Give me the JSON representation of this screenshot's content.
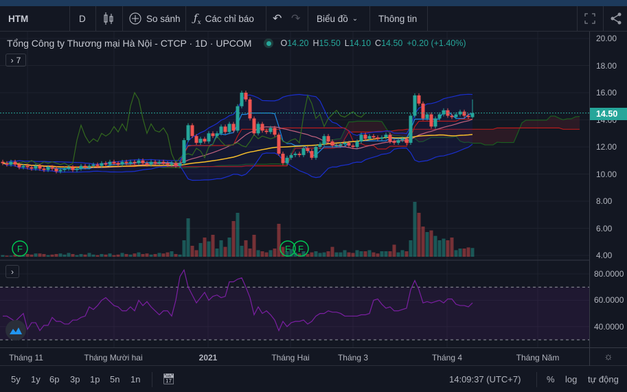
{
  "toolbar": {
    "symbol": "HTM",
    "interval": "D",
    "compare_label": "So sánh",
    "indicators_label": "Các chỉ báo",
    "chart_label": "Biểu đồ",
    "info_label": "Thông tin"
  },
  "legend": {
    "title": "Tổng Công ty Thương mại Hà Nội - CTCP · 1D · UPCOM",
    "open_key": "O",
    "open": "14.20",
    "high_key": "H",
    "high": "15.50",
    "low_key": "L",
    "low": "14.10",
    "close_key": "C",
    "close": "14.50",
    "change": "+0.20 (+1.40%)",
    "indicator_count": "7"
  },
  "price_axis": {
    "ticks": [
      "20.00",
      "18.00",
      "16.00",
      "14.00",
      "12.00",
      "10.00",
      "8.00",
      "6.00",
      "4.00"
    ],
    "last_price": "14.50"
  },
  "rsi_axis": {
    "ticks": [
      "80.0000",
      "60.0000",
      "40.0000"
    ]
  },
  "time_axis": {
    "labels": [
      "Tháng 11",
      "Tháng Mười hai",
      "2021",
      "Tháng Hai",
      "Tháng 3",
      "Tháng 4",
      "Tháng Năm"
    ]
  },
  "bottom_bar": {
    "ranges": [
      "5y",
      "1y",
      "6p",
      "3p",
      "1p",
      "5n",
      "1n"
    ],
    "clock": "14:09:37 (UTC+7)",
    "percent": "%",
    "log": "log",
    "auto": "tự động"
  },
  "markers": {
    "label": "F"
  },
  "colors": {
    "up": "#26a69a",
    "down": "#ef5350",
    "background": "#131722",
    "rsi": "#7b1fa2"
  },
  "chart_data": {
    "type": "candlestick",
    "last_bar": {
      "open": 14.2,
      "high": 15.5,
      "low": 14.1,
      "close": 14.5
    },
    "price_range": [
      4,
      20
    ],
    "closes": [
      10.8,
      10.7,
      10.9,
      10.7,
      10.5,
      10.6,
      10.5,
      10.4,
      10.6,
      10.4,
      10.3,
      10.5,
      10.4,
      10.2,
      10.3,
      10.4,
      10.5,
      10.3,
      10.4,
      10.6,
      10.5,
      10.6,
      10.7,
      10.6,
      10.8,
      10.7,
      10.9,
      10.8,
      10.7,
      10.9,
      10.8,
      10.9,
      10.8,
      11.0,
      10.8,
      10.7,
      10.9,
      10.8,
      10.9,
      10.8,
      10.7,
      10.8,
      10.6,
      10.8,
      12.5,
      13.6,
      12.8,
      12.3,
      12.6,
      12.4,
      13.0,
      12.8,
      13.0,
      13.5,
      13.1,
      13.7,
      13.2,
      15.0,
      16.0,
      15.5,
      14.1,
      13.0,
      13.7,
      13.2,
      13.1,
      13.4,
      12.9,
      11.5,
      10.8,
      11.2,
      11.4,
      11.5,
      11.4,
      11.9,
      11.7,
      11.2,
      12.0,
      12.2,
      12.8,
      12.4,
      12.1,
      12.1,
      12.2,
      12.3,
      12.1,
      12.0,
      12.4,
      12.9,
      12.6,
      12.8,
      12.7,
      12.6,
      12.7,
      12.9,
      12.4,
      12.3,
      12.5,
      12.6,
      12.3,
      14.3,
      15.8,
      15.2,
      14.1,
      14.4,
      13.5,
      14.1,
      14.4,
      14.7,
      14.3,
      14.2,
      14.4,
      14.6,
      14.3,
      14.2,
      14.5
    ],
    "volume_relative": [
      3,
      2,
      2,
      4,
      3,
      3,
      5,
      4,
      6,
      6,
      5,
      3,
      4,
      5,
      6,
      4,
      7,
      5,
      3,
      5,
      4,
      7,
      4,
      3,
      5,
      4,
      6,
      3,
      4,
      7,
      5,
      4,
      6,
      8,
      5,
      6,
      4,
      5,
      7,
      6,
      8,
      10,
      5,
      4,
      30,
      70,
      20,
      12,
      25,
      35,
      28,
      40,
      15,
      30,
      18,
      35,
      65,
      80,
      20,
      30,
      15,
      40,
      12,
      10,
      8,
      12,
      15,
      60,
      18,
      10,
      14,
      8,
      6,
      10,
      5,
      8,
      10,
      7,
      8,
      10,
      18,
      8,
      8,
      12,
      8,
      7,
      12,
      10,
      10,
      12,
      8,
      6,
      10,
      10,
      10,
      22,
      8,
      12,
      10,
      30,
      100,
      80,
      55,
      45,
      48,
      38,
      30,
      33,
      30,
      35,
      12,
      15,
      15,
      17,
      16
    ],
    "rsi": [
      48,
      48,
      46,
      44,
      47,
      50,
      38,
      43,
      43,
      37,
      41,
      41,
      47,
      44,
      44,
      42,
      42,
      45,
      45,
      47,
      48,
      55,
      53,
      56,
      60,
      62,
      59,
      56,
      55,
      52,
      52,
      55,
      52,
      60,
      56,
      59,
      55,
      52,
      49,
      52,
      52,
      48,
      60,
      78,
      83,
      70,
      64,
      58,
      62,
      66,
      60,
      63,
      64,
      62,
      63,
      74,
      74,
      76,
      77,
      70,
      62,
      49,
      55,
      50,
      52,
      49,
      45,
      37,
      44,
      40,
      43,
      44,
      44,
      45,
      42,
      44,
      48,
      50,
      50,
      52,
      51,
      51,
      50,
      48,
      48,
      48,
      48,
      49,
      49,
      50,
      60,
      61,
      57,
      54,
      55,
      52,
      52,
      53,
      54,
      68,
      75,
      68,
      58,
      59,
      58,
      59,
      60,
      58,
      61,
      61,
      57,
      56,
      56,
      55,
      58
    ],
    "rsi_range": [
      30,
      70
    ],
    "marker_bars": [
      4,
      69,
      72
    ]
  }
}
